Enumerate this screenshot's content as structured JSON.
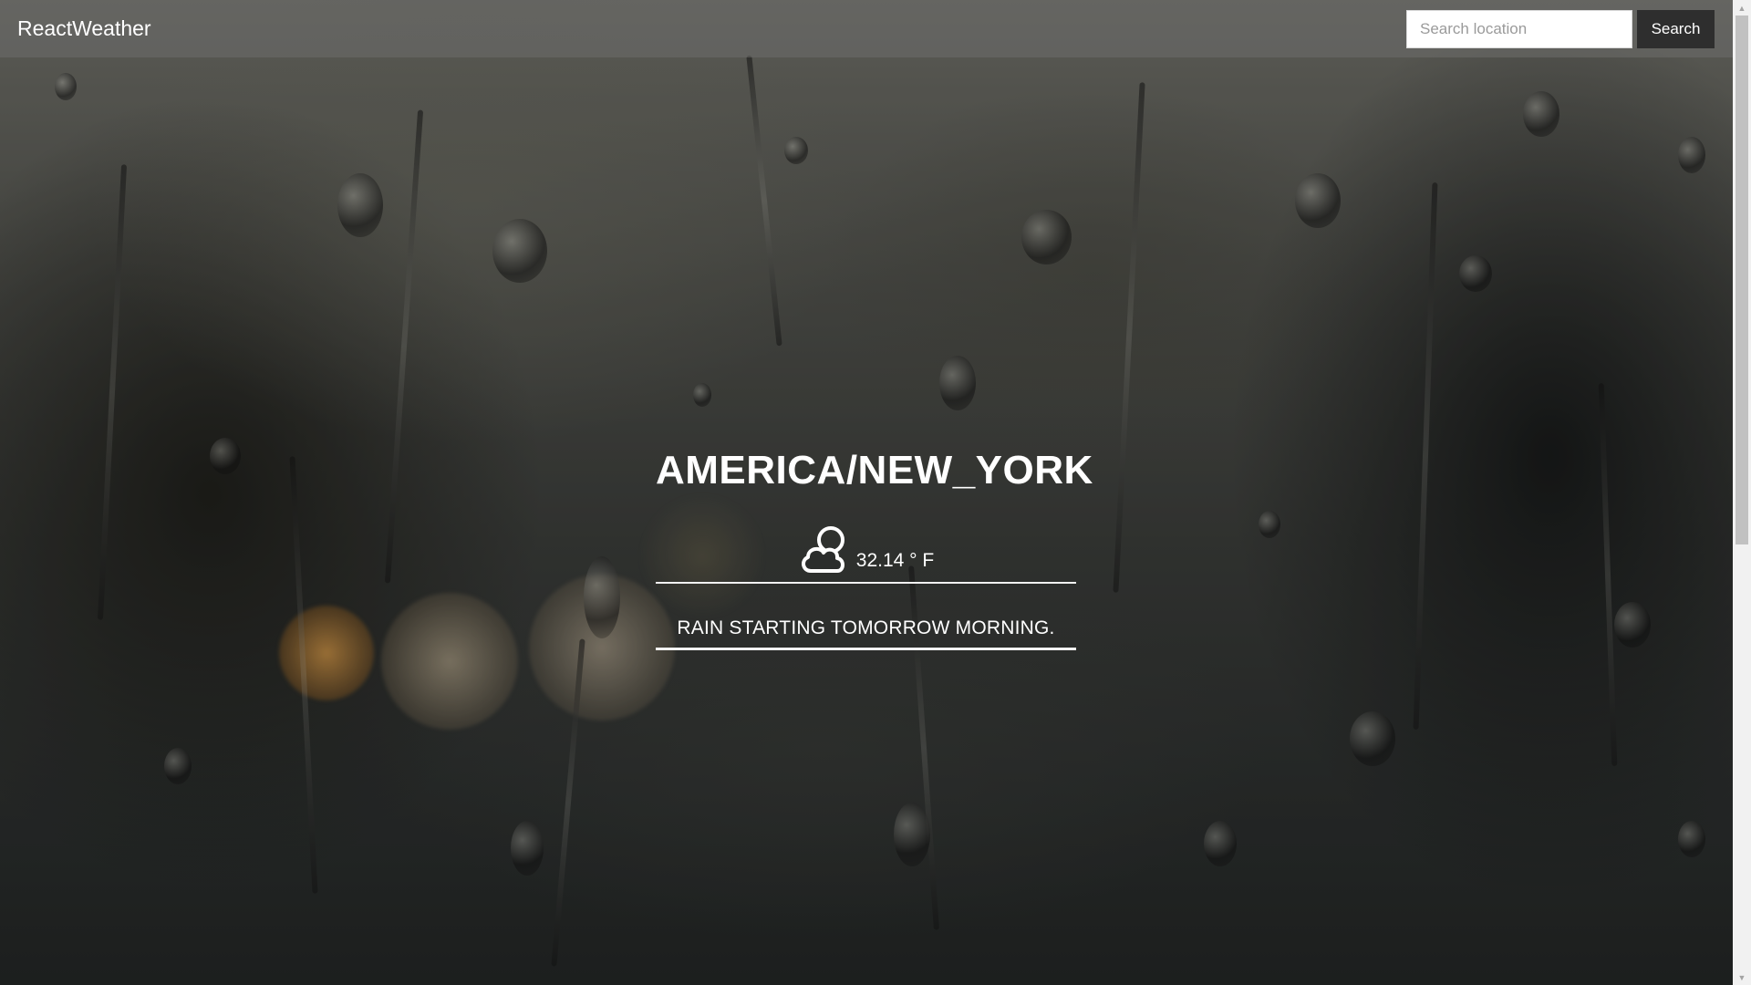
{
  "header": {
    "brand": "ReactWeather",
    "search_placeholder": "Search location",
    "search_value": "",
    "search_button_label": "Search"
  },
  "weather": {
    "location": "AMERICA/NEW_YORK",
    "temperature": "32.14 ° F",
    "summary": "RAIN STARTING TOMORROW MORNING.",
    "icon": "partly-cloudy-icon"
  },
  "colors": {
    "header_bg": "#6e6e6c",
    "button_bg": "#2e2e2e",
    "text": "#ffffff"
  }
}
